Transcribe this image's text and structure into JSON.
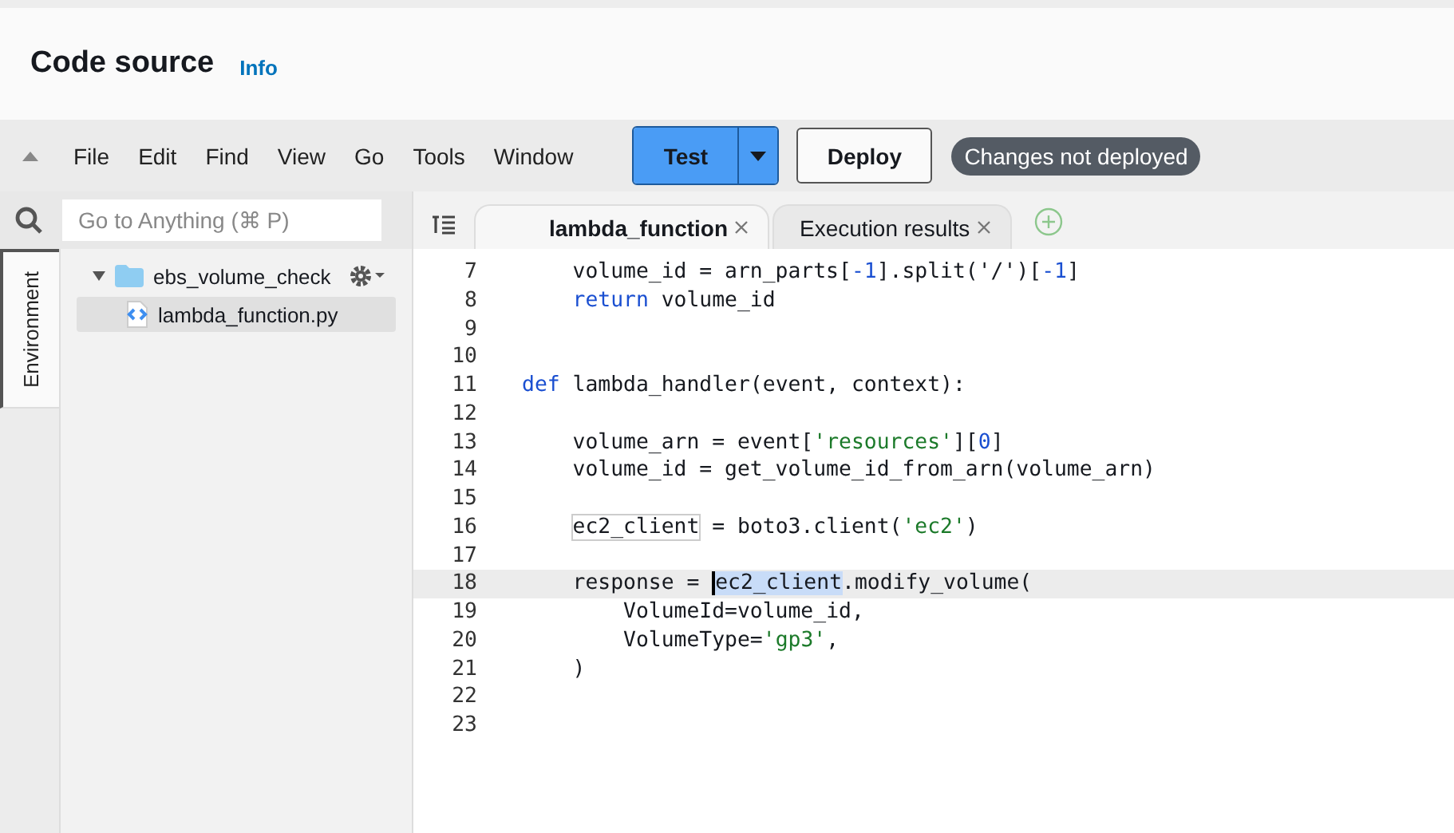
{
  "header": {
    "title": "Code source",
    "info_link": "Info"
  },
  "menu": [
    "File",
    "Edit",
    "Find",
    "View",
    "Go",
    "Tools",
    "Window"
  ],
  "actions": {
    "test": "Test",
    "deploy": "Deploy",
    "status": "Changes not deployed"
  },
  "sidebar": {
    "search_placeholder": "Go to Anything (⌘ P)",
    "panel_tab": "Environment",
    "tree": [
      {
        "name": "ebs_volume_check",
        "kind": "folder",
        "expanded": true,
        "selected": false,
        "children": [
          {
            "name": "lambda_function.py",
            "kind": "file",
            "selected": true
          }
        ]
      }
    ]
  },
  "tabs": [
    {
      "label": "lambda_function",
      "selected": true
    },
    {
      "label": "Execution results",
      "selected": false
    }
  ],
  "editor": {
    "lines": [
      {
        "number": "7",
        "current": false,
        "tokens": [
          {
            "text": "    volume_id = arn_parts[",
            "kind": "plain"
          },
          {
            "text": "-1",
            "kind": "number"
          },
          {
            "text": "].split(",
            "kind": "plain"
          },
          {
            "text": "'/'",
            "kind": "plain"
          },
          {
            "text": ")[",
            "kind": "plain"
          },
          {
            "text": "-1",
            "kind": "number"
          },
          {
            "text": "]",
            "kind": "plain"
          }
        ]
      },
      {
        "number": "8",
        "current": false,
        "tokens": [
          {
            "text": "    return",
            "kind": "keyword"
          },
          {
            "text": " volume_id",
            "kind": "plain"
          }
        ]
      },
      {
        "number": "9",
        "current": false
      },
      {
        "number": "10",
        "current": false
      },
      {
        "number": "11",
        "current": false,
        "tokens": [
          {
            "text": "def",
            "kind": "keyword"
          },
          {
            "text": " lambda_handler(event, context):",
            "kind": "plain"
          }
        ]
      },
      {
        "number": "12",
        "current": false
      },
      {
        "number": "13",
        "current": false,
        "tokens": [
          {
            "text": "    volume_arn = event[",
            "kind": "plain"
          },
          {
            "text": "'resources'",
            "kind": "string"
          },
          {
            "text": "][",
            "kind": "plain"
          },
          {
            "text": "0",
            "kind": "number"
          },
          {
            "text": "]",
            "kind": "plain"
          }
        ]
      },
      {
        "number": "14",
        "current": false,
        "tokens": [
          {
            "text": "    volume_id = get_volume_id_from_arn(volume_arn)",
            "kind": "plain"
          }
        ]
      },
      {
        "number": "15",
        "current": false
      },
      {
        "number": "16",
        "current": false,
        "tokens": [
          {
            "text": "    ec2_client",
            "kind": "match"
          },
          {
            "text": " = boto3.client(",
            "kind": "plain"
          },
          {
            "text": "'ec2'",
            "kind": "string"
          },
          {
            "text": ")",
            "kind": "plain"
          }
        ]
      },
      {
        "number": "17",
        "current": false
      },
      {
        "number": "18",
        "current": true,
        "tokens": [
          {
            "text": "    response = ",
            "kind": "plain"
          },
          {
            "text": "ec2_client",
            "kind": "selection"
          },
          {
            "text": ".modify_volume(",
            "kind": "plain"
          }
        ]
      },
      {
        "number": "19",
        "current": false,
        "tokens": [
          {
            "text": "        VolumeId=volume_id,",
            "kind": "plain"
          }
        ]
      },
      {
        "number": "20",
        "current": false,
        "tokens": [
          {
            "text": "        VolumeType=",
            "kind": "plain"
          },
          {
            "text": "'gp3'",
            "kind": "string"
          },
          {
            "text": ",",
            "kind": "plain"
          }
        ]
      },
      {
        "number": "21",
        "current": false,
        "tokens": [
          {
            "text": "    )",
            "kind": "plain"
          }
        ]
      },
      {
        "number": "22",
        "current": false
      },
      {
        "number": "23",
        "current": false
      }
    ]
  }
}
